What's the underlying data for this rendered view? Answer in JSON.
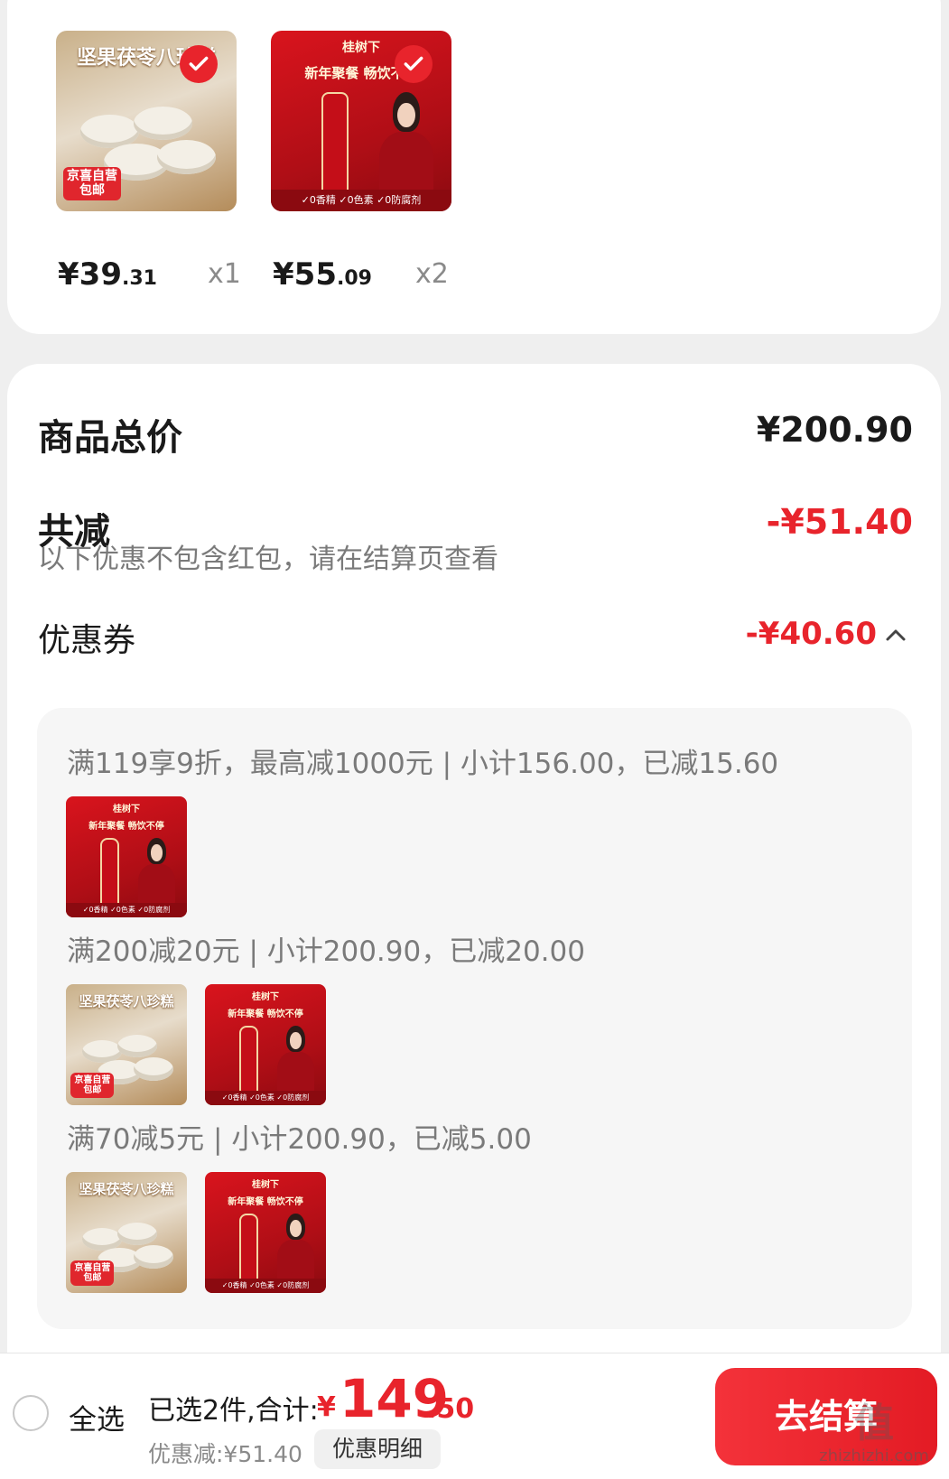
{
  "cart_items": [
    {
      "name": "cake",
      "title": "坚果茯苓八珍糕",
      "badge": "京喜自营\n包邮",
      "price_int": "¥39",
      "price_dec": ".31",
      "qty": "x1",
      "selected": true
    },
    {
      "name": "drink",
      "brand": "桂树下",
      "title": "新年聚餐 畅饮不停",
      "price_int": "¥55",
      "price_dec": ".09",
      "qty": "x2",
      "selected": true
    }
  ],
  "summary": {
    "total_label": "商品总价",
    "total_value": "¥200.90",
    "discount_label": "共减",
    "discount_value": "-¥51.40",
    "hint": "以下优惠不包含红包，请在结算页查看",
    "coupon_label": "优惠券",
    "coupon_value": "-¥40.60"
  },
  "coupons": [
    {
      "rule": "满119享9折，最高减1000元 | 小计156.00，已减15.60",
      "products": [
        "drink"
      ]
    },
    {
      "rule": "满200减20元 | 小计200.90，已减20.00",
      "products": [
        "cake",
        "drink"
      ]
    },
    {
      "rule": "满70减5元 | 小计200.90，已减5.00",
      "products": [
        "cake",
        "drink"
      ]
    }
  ],
  "bottom_bar": {
    "select_all": "全选",
    "selected_text": "已选2件,合计:",
    "total_yen": "¥",
    "total_int": "149",
    "total_dec": ".50",
    "discount_text": "优惠减:¥51.40",
    "detail_button": "优惠明细",
    "checkout_button": "去结算"
  },
  "watermark": {
    "text": "值",
    "url": "zhizhizhi.com"
  },
  "colors": {
    "accent": "#e8242c",
    "page_bg": "#efefef",
    "panel_bg": "#f6f6f6"
  }
}
